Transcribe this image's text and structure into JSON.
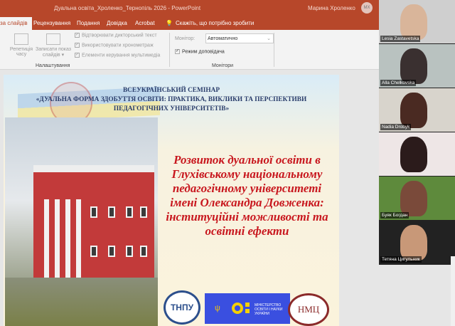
{
  "window": {
    "title": "Дуальна освіта_Хроленко_Тернопіль 2026  -  PowerPoint",
    "user": "Марина Хроленко",
    "avatar": "МХ"
  },
  "tabs": [
    {
      "label": "за слайдів",
      "active": true
    },
    {
      "label": "Рецензування"
    },
    {
      "label": "Подання"
    },
    {
      "label": "Довідка"
    },
    {
      "label": "Acrobat"
    }
  ],
  "tell_me": "Скажіть, що потрібно зробити",
  "ribbon": {
    "rehearse": "Репетиція часу",
    "record": "Записати показ слайдів ▾",
    "checks": [
      {
        "label": "Відтворювати дикторський текст",
        "checked": true
      },
      {
        "label": "Використовувати хронометраж",
        "checked": true
      },
      {
        "label": "Елементи керування мультимедіа",
        "checked": true
      }
    ],
    "group_setup": "Налаштування",
    "monitor_label": "Монітор:",
    "monitor_value": "Автоматично",
    "presenter_view": "Режим доповідача",
    "presenter_checked": true,
    "group_monitors": "Монітори"
  },
  "slide": {
    "header_line1": "ВСЕУКРАЇНСЬКИЙ СЕМІНАР",
    "header_line2": "«ДУАЛЬНА ФОРМА ЗДОБУТТЯ ОСВІТИ: ПРАКТИКА, ВИКЛИКИ ТА ПЕРСПЕКТИВИ",
    "header_line3": "ПЕДАГОГІЧНИХ УНІВЕРСИТЕТІВ»",
    "title": "Розвиток дуальної освіти в Глухівському національному педагогічному університеті імені Олександра Довженка: інституційні можливості та освітні ефекти",
    "logos": {
      "tnpu": "ТНПУ",
      "ministry": "МІНІСТЕРСТВО ОСВІТИ І НАУКИ УКРАЇНИ",
      "nmc": "НМЦ"
    }
  },
  "participants": [
    {
      "name": "Lesia Zastavetska",
      "bg": "#cfcfcf",
      "face": "#d9b59a"
    },
    {
      "name": "Alla Chelkovska",
      "bg": "#b9c2c0",
      "face": "#3a3030"
    },
    {
      "name": "Nadia Drobyk",
      "bg": "#d8d4cc",
      "face": "#4a2a22"
    },
    {
      "name": "",
      "bg": "#eee6e6",
      "face": "#2b1b1b"
    },
    {
      "name": "Буяк Богдан",
      "bg": "#5e8a3c",
      "face": "#7a4a3a"
    },
    {
      "name": "Тетяна Цигульник",
      "bg": "#222222",
      "face": "#c89878"
    }
  ]
}
